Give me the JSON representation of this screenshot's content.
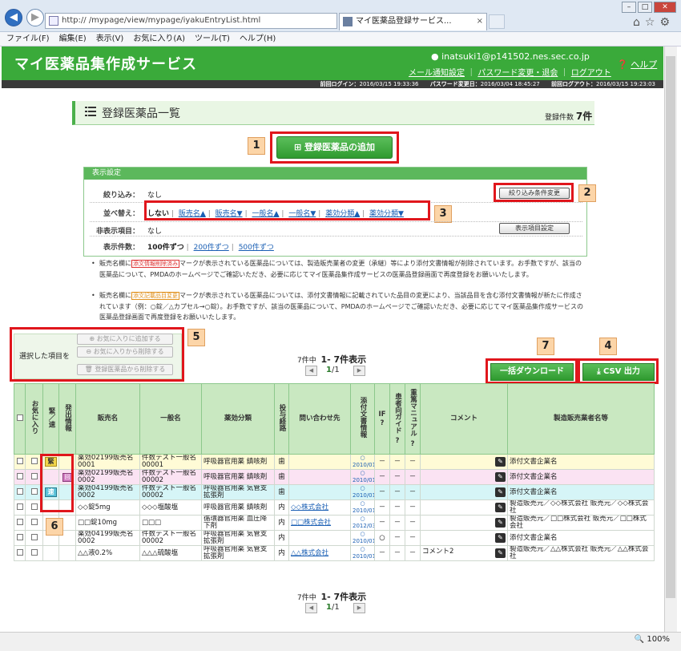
{
  "browser": {
    "address": "http://                              /mypage/view/mypage/iyakuEntryList.html",
    "tab_title": "マイ医薬品登録サービス...",
    "menu": [
      "ファイル(F)",
      "編集(E)",
      "表示(V)",
      "お気に入り(A)",
      "ツール(T)",
      "ヘルプ(H)"
    ],
    "zoom": "100%"
  },
  "header": {
    "title": "マイ医薬品集作成サービス",
    "user": "inatsuki1@p141502.nes.sec.co.jp",
    "link_mail": "メール通知設定",
    "link_password": "パスワード変更・退会",
    "link_logout": "ログアウト",
    "help": "ヘルプ",
    "last_login_label": "前回ログイン：",
    "last_login": "2016/03/15 19:33:36",
    "pw_changed_label": "パスワード変更日：",
    "pw_changed": "2016/03/04 18:45:27",
    "last_logout_label": "前回ログアウト：",
    "last_logout": "2016/03/15 19:23:03"
  },
  "page": {
    "title": "登録医薬品一覧",
    "count_label": "登録件数",
    "count": "7件",
    "add_button": "登録医薬品の追加"
  },
  "settings": {
    "header": "表示設定",
    "filter_label": "絞り込み：",
    "filter_value": "なし",
    "filter_button": "絞り込み条件変更",
    "sort_label": "並べ替え：",
    "sort_current": "しない",
    "sort_options": [
      "販売名▲",
      "販売名▼",
      "一般名▲",
      "一般名▼",
      "薬効分類▲",
      "薬効分類▼"
    ],
    "hidden_label": "非表示項目：",
    "hidden_value": "なし",
    "hidden_button": "表示項目設定",
    "perpage_label": "表示件数：",
    "perpage_current": "100件ずつ",
    "perpage_options": [
      "200件ずつ",
      "500件ずつ"
    ]
  },
  "notes": {
    "n1_a": "販売名欄に",
    "n1_badge": "添文情報削除済み",
    "n1_b": "マークが表示されている医薬品については、製造販売業者の変更（承継）等により添付文書情報が削除されています。お手数ですが、該当の医薬品について、PMDAのホームページでご確認いただき、必要に応じてマイ医薬品集作成サービスの医薬品登録画面で再度登録をお願いいたします。",
    "n2_a": "販売名欄に",
    "n2_badge": "添文記載品目変更",
    "n2_b": "マークが表示されている医薬品については、添付文書情報に記載されていた品目の変更により、当該品目を含む添付文書情報が新たに作成されています（例：○錠／△カプセル→○錠）。お手数ですが、該当の医薬品について、PMDAのホームページでご確認いただき、必要に応じてマイ医薬品集作成サービスの医薬品登録画面で再度登録をお願いいたします。"
  },
  "selection": {
    "label": "選択した項目を",
    "add_fav": "お気に入りに追加する",
    "remove_fav": "お気に入りから削除する",
    "delete": "登録医薬品から削除する"
  },
  "pager": {
    "summary_a": "7件中",
    "summary_b": "1- 7件表示",
    "page": "1",
    "total": "/1"
  },
  "actions": {
    "bulk_download": "一括ダウンロード",
    "csv": "CSV 出力"
  },
  "callouts": [
    "1",
    "2",
    "3",
    "4",
    "5",
    "6",
    "7"
  ],
  "table": {
    "headers": [
      "お気に入り",
      "緊／速",
      "発出情報",
      "販売名",
      "一般名",
      "薬効分類",
      "投与経路",
      "問い合わせ先",
      "添付文書情報",
      "IF",
      "患者向ガイド",
      "重篤マニュアル",
      "コメント",
      "製造販売業者名等"
    ],
    "help_mark": "?",
    "rows": [
      {
        "tag": "緊",
        "info": "",
        "name": "薬効02199販売名0001",
        "generic": "件数テスト一般名00001",
        "category": "呼吸器官用薬 鎮咳剤",
        "route": "歯",
        "contact": "",
        "doc_date": "2010/01",
        "if": "－",
        "guide": "－",
        "manual": "－",
        "comment": "",
        "maker": "添付文書企業名"
      },
      {
        "tag": "",
        "info": "回",
        "name": "薬効02199販売名0002",
        "generic": "件数テスト一般名00002",
        "category": "呼吸器官用薬 鎮咳剤",
        "route": "歯",
        "contact": "",
        "doc_date": "2010/01",
        "if": "－",
        "guide": "－",
        "manual": "－",
        "comment": "",
        "maker": "添付文書企業名"
      },
      {
        "tag": "速",
        "info": "",
        "name": "薬効04199販売名0002",
        "generic": "件数テスト一般名00002",
        "category": "呼吸器官用薬 気管支拡張剤",
        "route": "歯",
        "contact": "",
        "doc_date": "2010/01",
        "if": "－",
        "guide": "－",
        "manual": "－",
        "comment": "",
        "maker": "添付文書企業名"
      },
      {
        "tag": "",
        "info": "",
        "name": "◇◇錠5mg",
        "generic": "◇◇◇塩酸塩",
        "category": "呼吸器官用薬 鎮咳剤",
        "route": "内",
        "contact": "◇◇株式会社",
        "doc_date": "2010/01",
        "if": "－",
        "guide": "－",
        "manual": "－",
        "comment": "",
        "maker": "製造販売元／◇◇株式会社 販売元／◇◇株式会社"
      },
      {
        "tag": "",
        "info": "",
        "name": "□□錠10mg",
        "generic": "□□□",
        "category": "循環器官用薬 血圧降下剤",
        "route": "内",
        "contact": "□□株式会社",
        "doc_date": "2012/03",
        "if": "－",
        "guide": "－",
        "manual": "－",
        "comment": "",
        "maker": "製造販売元／□□株式会社 販売元／□□株式会社"
      },
      {
        "tag": "",
        "info": "",
        "name": "薬効04199販売名0002",
        "generic": "件数テスト一般名00002",
        "category": "呼吸器官用薬 気管支拡張剤",
        "route": "内",
        "contact": "",
        "doc_date": "2010/01",
        "if": "○",
        "guide": "－",
        "manual": "－",
        "comment": "",
        "maker": "添付文書企業名"
      },
      {
        "tag": "",
        "info": "",
        "name": "△△液0.2%",
        "generic": "△△△硫酸塩",
        "category": "呼吸器官用薬 気管支拡張剤",
        "route": "内",
        "contact": "△△株式会社",
        "doc_date": "2010/01",
        "if": "－",
        "guide": "－",
        "manual": "－",
        "comment": "コメント2",
        "maker": "製造販売元／△△株式会社 販売元／△△株式会社"
      }
    ]
  }
}
